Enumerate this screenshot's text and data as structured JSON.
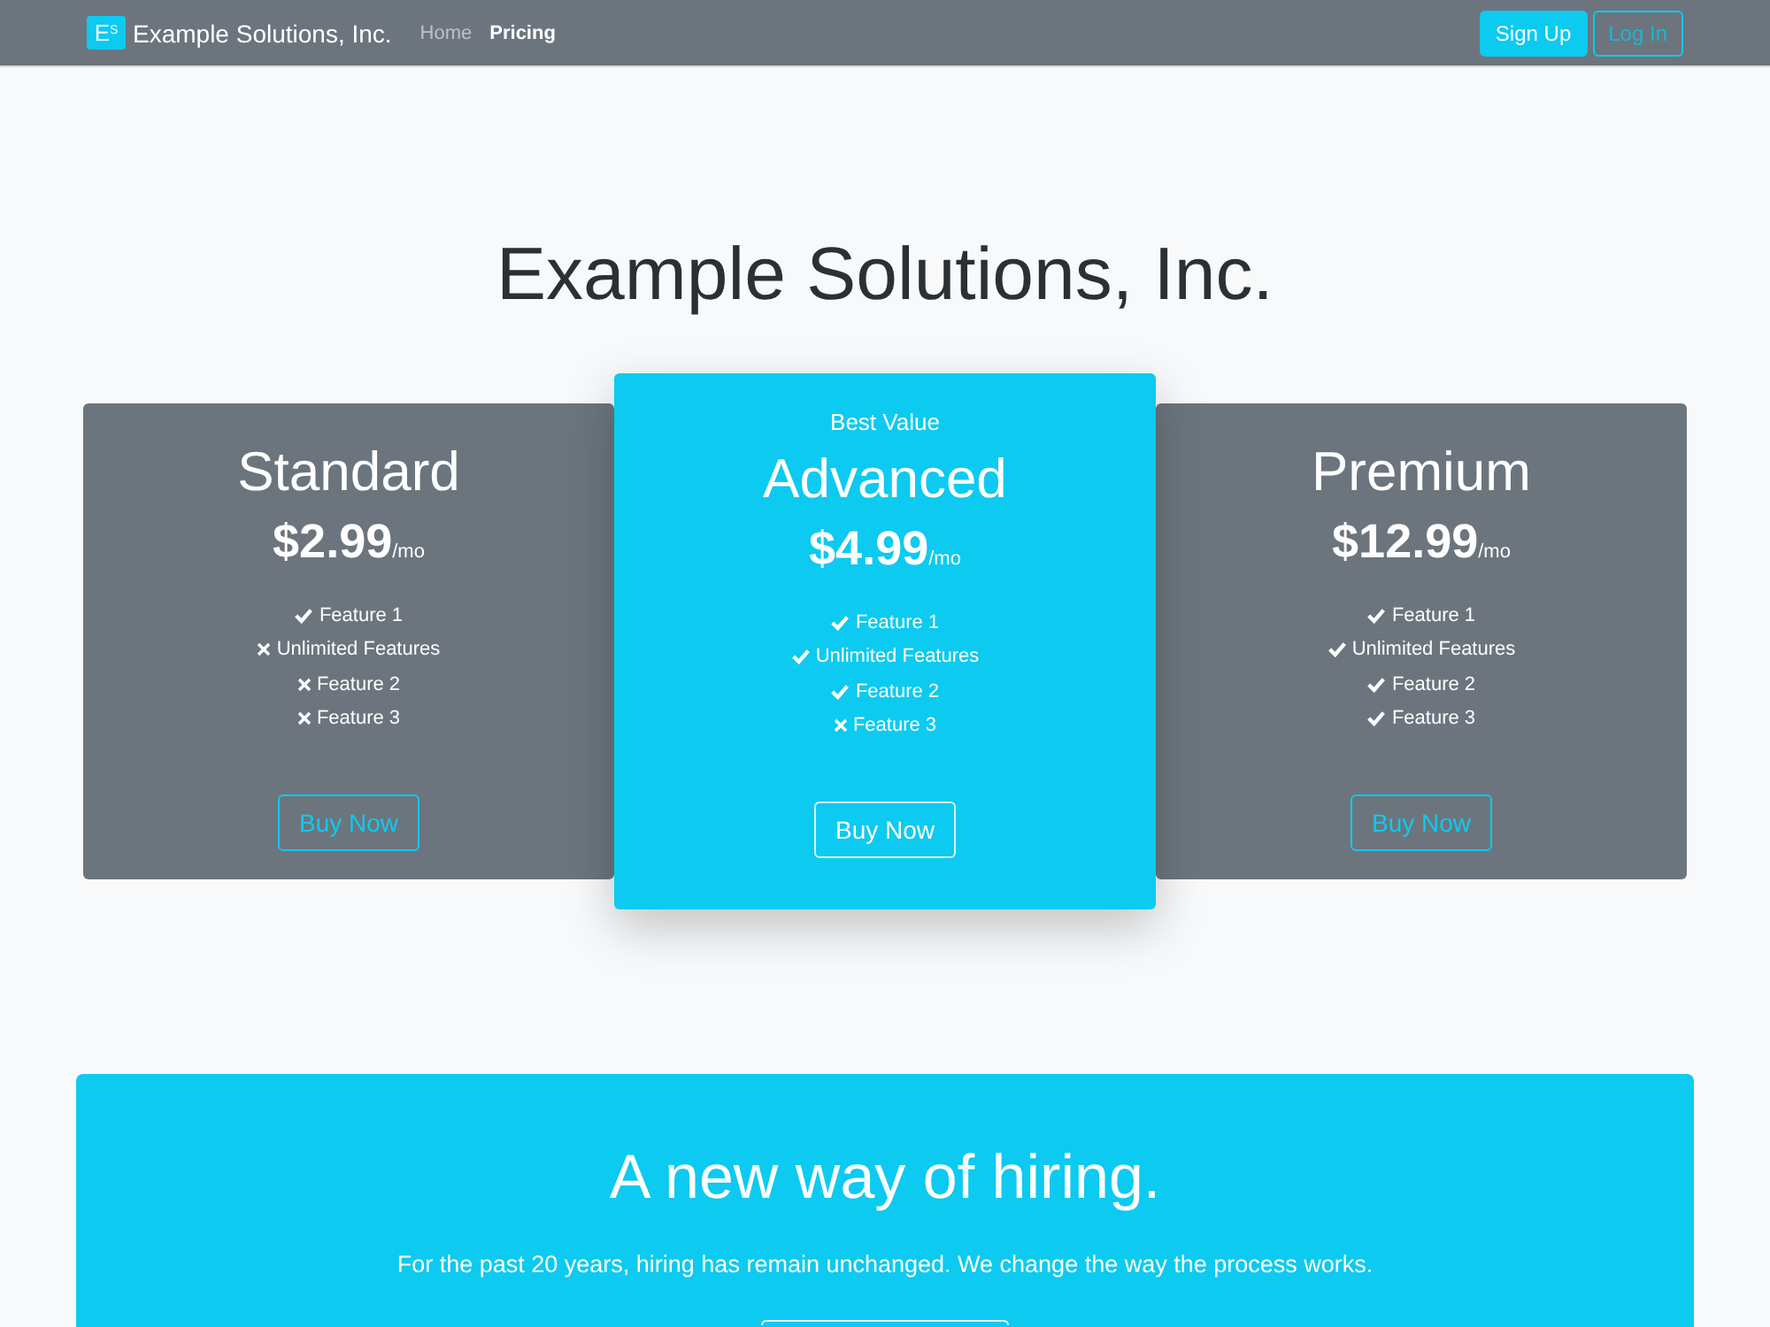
{
  "navbar": {
    "logo": "E$^{S}$",
    "brand": "Example Solutions, Inc.",
    "links": [
      {
        "label": "Home",
        "selected": false
      },
      {
        "label": "Pricing",
        "selected": true
      }
    ],
    "buttons": [
      {
        "label": "Sign Up",
        "kind": "filled"
      },
      {
        "label": "Log In",
        "kind": "outline"
      }
    ]
  },
  "hero": {
    "title": "Example Solutions, Inc."
  },
  "plans": [
    {
      "name": "Standard",
      "featured": false,
      "price": "$2.99",
      "period": "/mo",
      "features": [
        {
          "label": "Feature 1",
          "included": true
        },
        {
          "label": "Unlimited Features",
          "included": false
        },
        {
          "label": "Feature 2",
          "included": false
        },
        {
          "label": "Feature 3",
          "included": false
        }
      ],
      "button": "Buy Now"
    },
    {
      "badge": "Best Value",
      "name": "Advanced",
      "featured": true,
      "price": "$4.99",
      "period": "/mo",
      "features": [
        {
          "label": "Feature 1",
          "included": true
        },
        {
          "label": "Unlimited Features",
          "included": true
        },
        {
          "label": "Feature 2",
          "included": true
        },
        {
          "label": "Feature 3",
          "included": false
        }
      ],
      "button": "Buy Now"
    },
    {
      "name": "Premium",
      "featured": false,
      "price": "$12.99",
      "period": "/mo",
      "features": [
        {
          "label": "Feature 1",
          "included": true
        },
        {
          "label": "Unlimited Features",
          "included": true
        },
        {
          "label": "Feature 2",
          "included": true
        },
        {
          "label": "Feature 3",
          "included": true
        }
      ],
      "button": "Buy Now"
    }
  ],
  "banner": {
    "title": "A new way of hiring.",
    "text": "For the past 20 years, hiring has remain unchanged. We change the way the process works.",
    "has_button": true
  }
}
